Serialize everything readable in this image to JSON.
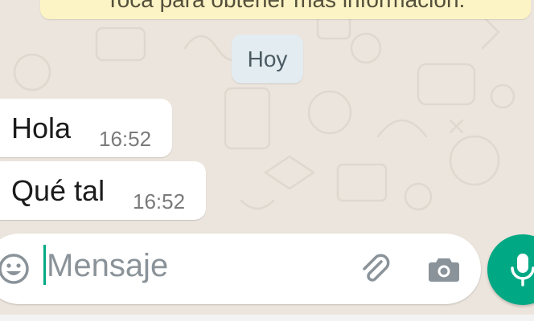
{
  "chat": {
    "encryption_notice": "Toca para obtener más información.",
    "date_separator": "Hoy",
    "messages": [
      {
        "text": "Hola",
        "time": "16:52"
      },
      {
        "text": "Qué tal",
        "time": "16:52"
      }
    ]
  },
  "composer": {
    "placeholder": "Mensaje",
    "icons": {
      "emoji": "emoji-icon",
      "attach": "paperclip-icon",
      "camera": "camera-icon",
      "mic": "microphone-icon"
    }
  },
  "colors": {
    "background": "#ece5dd",
    "accent": "#00a884",
    "bubble": "#ffffff",
    "notice": "#fdf4c5",
    "date_chip": "#e3ecf0"
  }
}
